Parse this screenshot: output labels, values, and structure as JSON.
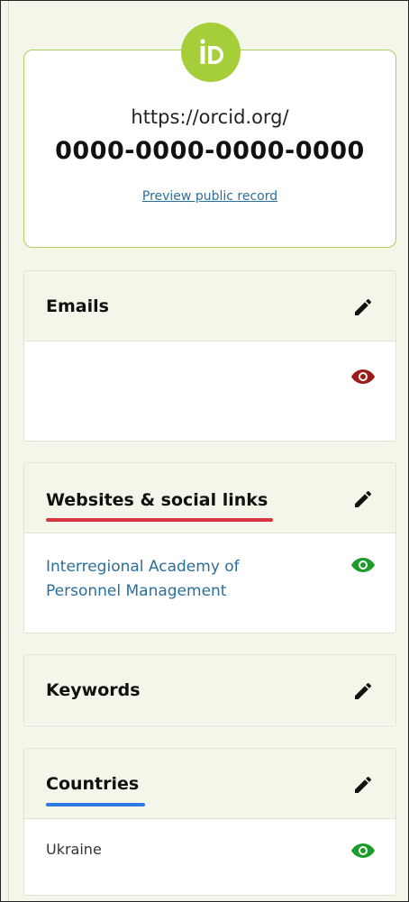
{
  "orcid": {
    "url_prefix": "https://orcid.org/",
    "id": "0000-0000-0000-0000",
    "preview_link": "Preview public record",
    "logo_icon": "orcid-id-logo",
    "logo_color": "#a6ce39"
  },
  "sections": {
    "emails": {
      "title": "Emails",
      "visibility": "private",
      "visibility_color": "#9b1b1b"
    },
    "websites": {
      "title": "Websites & social links",
      "accent_color": "#d8343f",
      "items": [
        {
          "label": "Interregional Academy of Personnel Management",
          "visibility": "public"
        }
      ]
    },
    "keywords": {
      "title": "Keywords"
    },
    "countries": {
      "title": "Countries",
      "accent_color": "#2f7be6",
      "items": [
        {
          "label": "Ukraine",
          "visibility": "public"
        }
      ]
    }
  },
  "colors": {
    "public_eye": "#1e9c2b",
    "private_eye": "#9b1b1b",
    "background": "#f3f6e9",
    "card_border": "#a9cf5b",
    "link": "#2b6f9b"
  },
  "icons": {
    "edit": "pencil-icon",
    "visibility": "eye-icon"
  }
}
